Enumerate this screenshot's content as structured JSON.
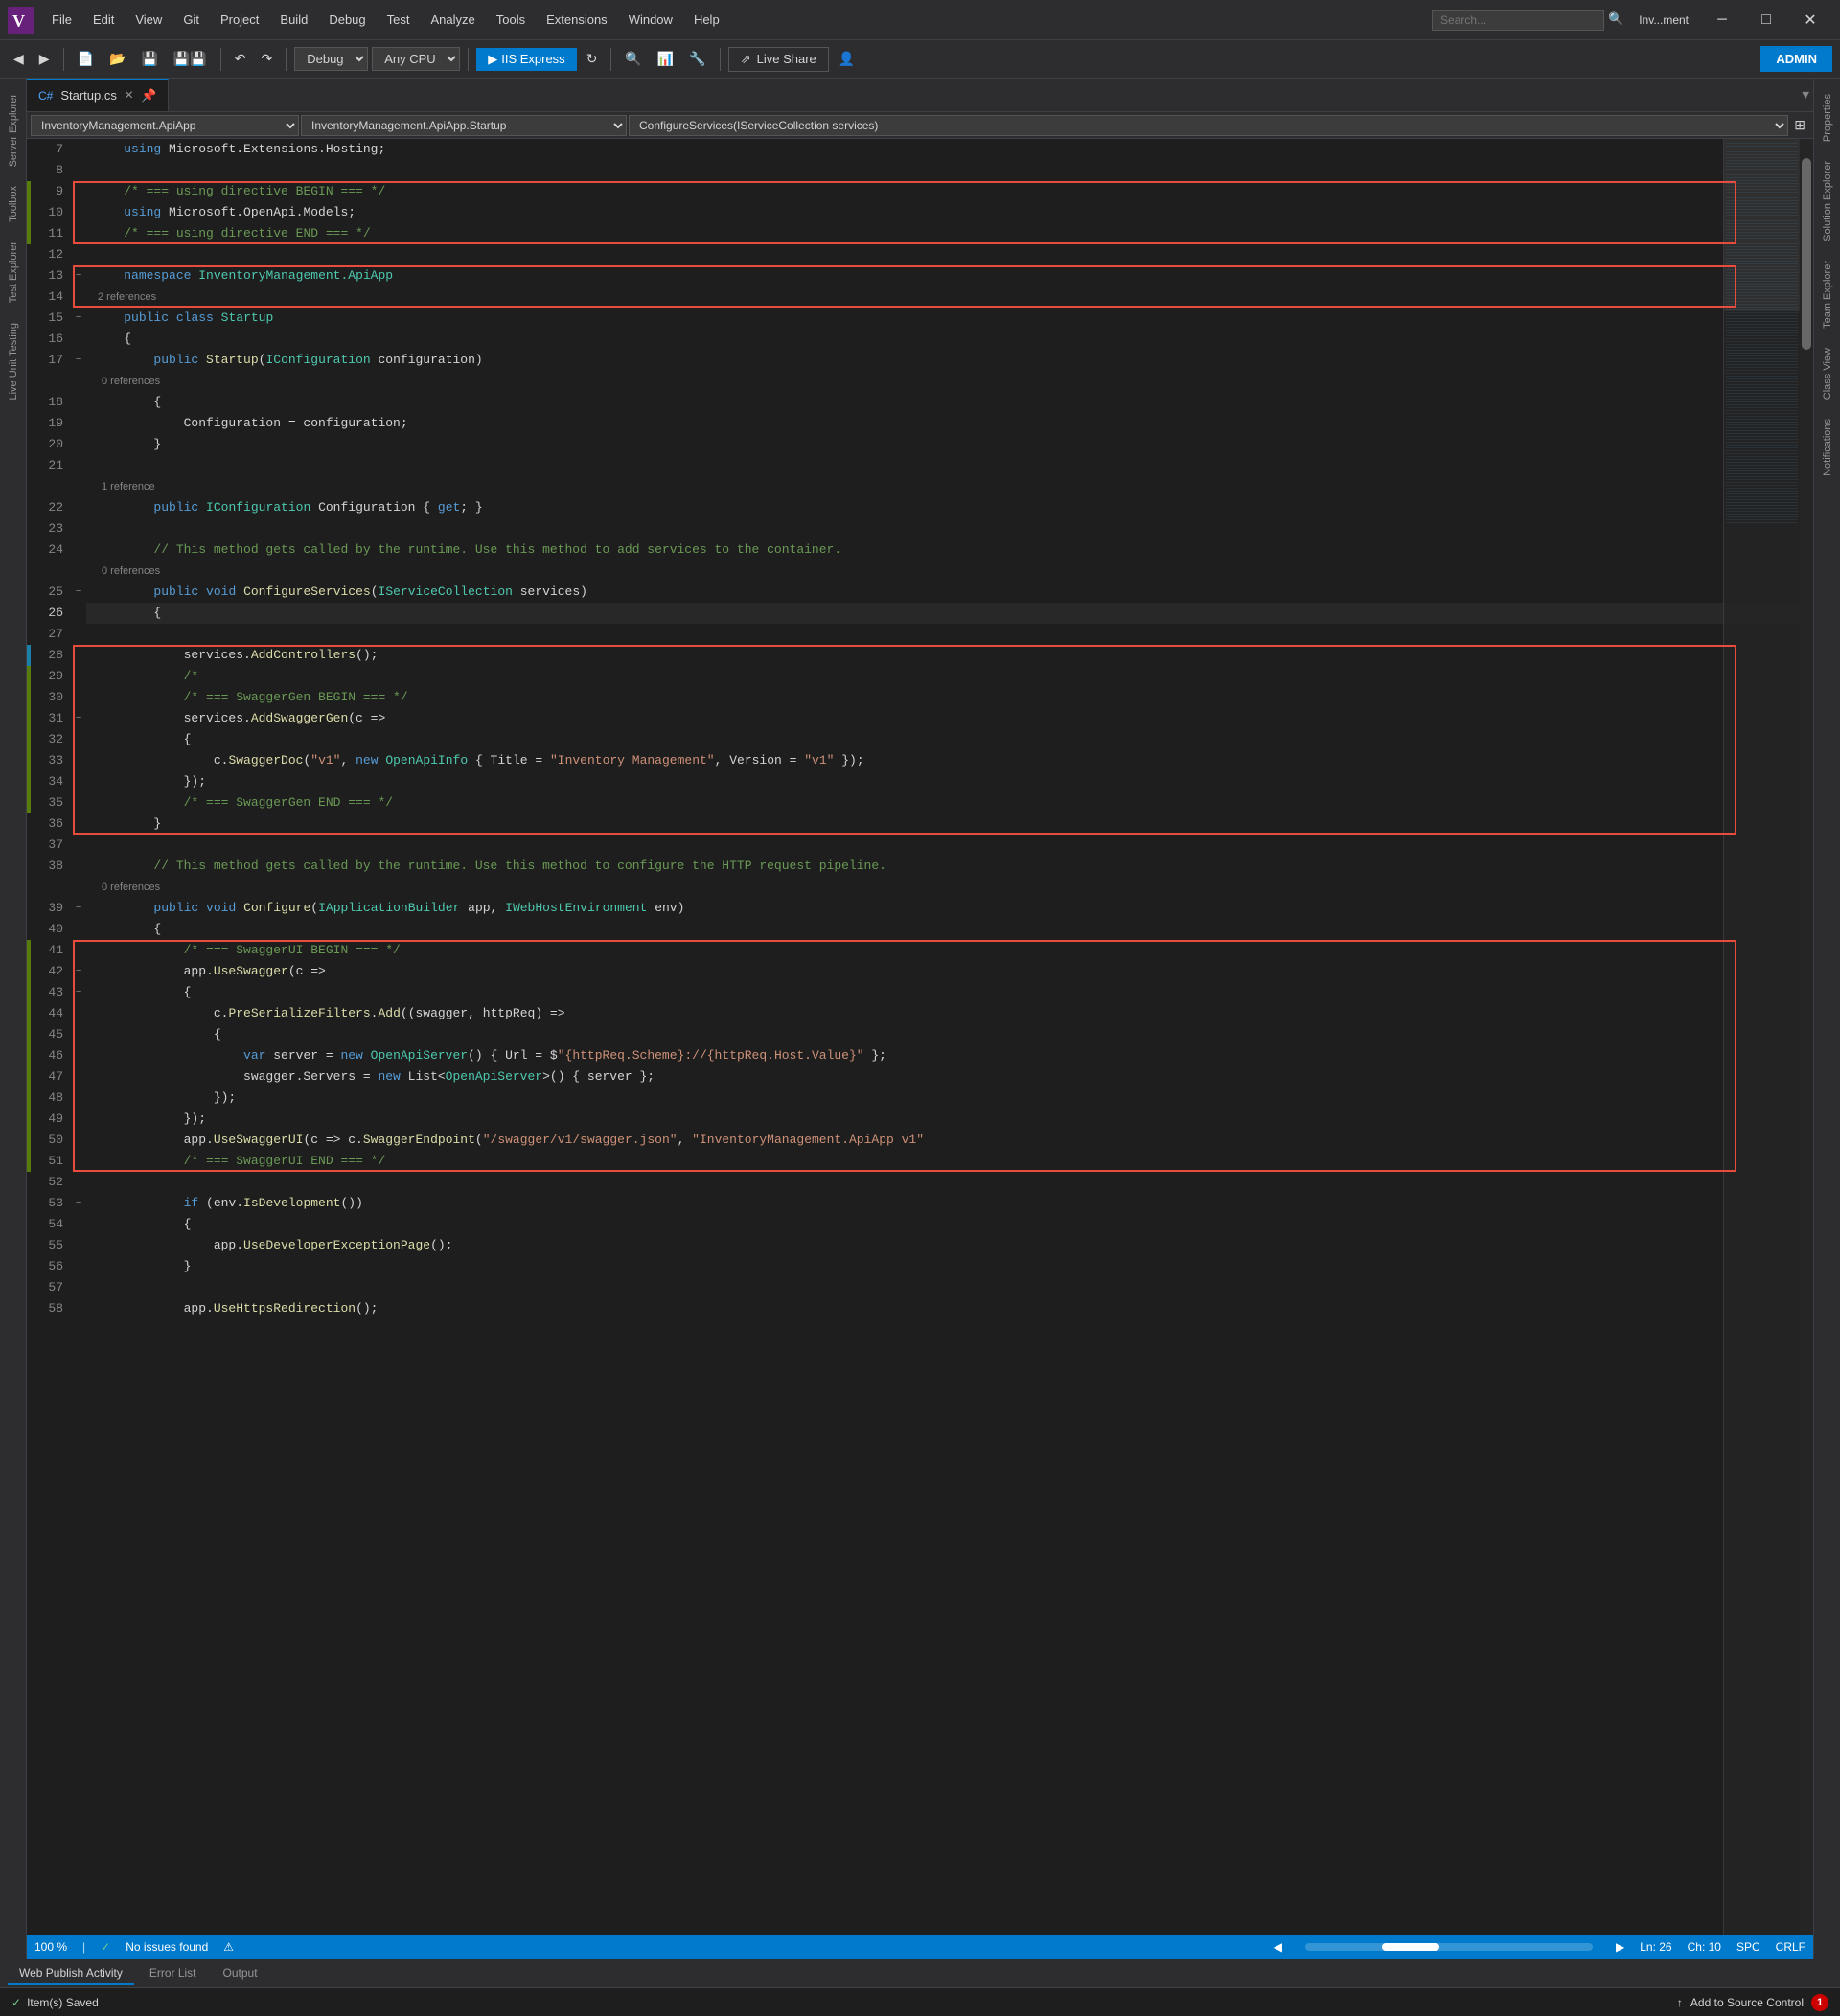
{
  "titleBar": {
    "title": "Inv...ment",
    "menuItems": [
      "File",
      "Edit",
      "View",
      "Git",
      "Project",
      "Build",
      "Debug",
      "Test",
      "Analyze",
      "Tools",
      "Extensions",
      "Window",
      "Help"
    ],
    "searchPlaceholder": "Search...",
    "controls": [
      "minimize",
      "maximize",
      "close"
    ]
  },
  "toolbar": {
    "debugMode": "Debug",
    "platform": "Any CPU",
    "runTarget": "IIS Express",
    "liveShare": "Live Share",
    "adminBtn": "ADMIN"
  },
  "tabBar": {
    "tabs": [
      {
        "label": "Startup.cs",
        "active": true,
        "modified": false
      },
      {
        "label": "Startup.cs",
        "active": false
      }
    ]
  },
  "navBar": {
    "namespace": "InventoryManagement.ApiApp",
    "class": "InventoryManagement.ApiApp.Startup",
    "method": "ConfigureServices(IServiceCollection services)"
  },
  "sidebarTabs": {
    "left": [
      "Server Explorer",
      "Toolbox",
      "Test Explorer",
      "Live Unit Testing"
    ],
    "right": [
      "Properties",
      "Solution Explorer",
      "Team Explorer",
      "Class View",
      "Notifications"
    ]
  },
  "codeLines": [
    {
      "num": 7,
      "git": "none",
      "indent": 0,
      "content": "    using Microsoft.Extensions.Hosting;"
    },
    {
      "num": 8,
      "git": "none",
      "indent": 0,
      "content": ""
    },
    {
      "num": 9,
      "git": "added",
      "indent": 0,
      "content": "    /* === using directive BEGIN === */"
    },
    {
      "num": 10,
      "git": "added",
      "indent": 0,
      "content": "    using Microsoft.OpenApi.Models;"
    },
    {
      "num": 11,
      "git": "added",
      "indent": 0,
      "content": "    /* === using directive END === */"
    },
    {
      "num": 12,
      "git": "none",
      "indent": 0,
      "content": ""
    },
    {
      "num": 13,
      "git": "none",
      "indent": 0,
      "content": "    namespace InventoryManagement.ApiApp"
    },
    {
      "num": 14,
      "git": "none",
      "indent": 0,
      "content": ""
    },
    {
      "num": 15,
      "git": "none",
      "indent": 0,
      "content": "    public class Startup"
    },
    {
      "num": 16,
      "git": "none",
      "indent": 0,
      "content": "    {"
    },
    {
      "num": 17,
      "git": "none",
      "indent": 0,
      "content": "        public Startup(IConfiguration configuration)"
    },
    {
      "num": 18,
      "git": "none",
      "indent": 0,
      "content": "        {"
    },
    {
      "num": 19,
      "git": "none",
      "indent": 0,
      "content": "            Configuration = configuration;"
    },
    {
      "num": 20,
      "git": "none",
      "indent": 0,
      "content": "        }"
    },
    {
      "num": 21,
      "git": "none",
      "indent": 0,
      "content": ""
    },
    {
      "num": 22,
      "git": "none",
      "indent": 0,
      "content": "        public IConfiguration Configuration { get; }"
    },
    {
      "num": 23,
      "git": "none",
      "indent": 0,
      "content": ""
    },
    {
      "num": 24,
      "git": "none",
      "indent": 0,
      "content": "        // This method gets called by the runtime. Use this method to add services to the container."
    },
    {
      "num": 25,
      "git": "none",
      "indent": 0,
      "content": "        public void ConfigureServices(IServiceCollection services)"
    },
    {
      "num": 26,
      "git": "none",
      "indent": 0,
      "content": "        {"
    },
    {
      "num": 27,
      "git": "none",
      "indent": 0,
      "content": ""
    },
    {
      "num": 28,
      "git": "modified",
      "indent": 0,
      "content": "            services.AddControllers();"
    },
    {
      "num": 29,
      "git": "added",
      "indent": 0,
      "content": "            /*"
    },
    {
      "num": 30,
      "git": "added",
      "indent": 0,
      "content": "            /* === SwaggerGen BEGIN === */"
    },
    {
      "num": 31,
      "git": "added",
      "indent": 0,
      "content": "            services.AddSwaggerGen(c =>"
    },
    {
      "num": 32,
      "git": "added",
      "indent": 0,
      "content": "            {"
    },
    {
      "num": 33,
      "git": "added",
      "indent": 0,
      "content": "                c.SwaggerDoc(\"v1\", new OpenApiInfo { Title = \"Inventory Management\", Version = \"v1\" });"
    },
    {
      "num": 34,
      "git": "added",
      "indent": 0,
      "content": "            });"
    },
    {
      "num": 35,
      "git": "added",
      "indent": 0,
      "content": "            /* === SwaggerGen END === */"
    },
    {
      "num": 36,
      "git": "none",
      "indent": 0,
      "content": "        }"
    },
    {
      "num": 37,
      "git": "none",
      "indent": 0,
      "content": ""
    },
    {
      "num": 38,
      "git": "none",
      "indent": 0,
      "content": "        // This method gets called by the runtime. Use this method to configure the HTTP request pipeline."
    },
    {
      "num": 39,
      "git": "none",
      "indent": 0,
      "content": "        public void Configure(IApplicationBuilder app, IWebHostEnvironment env)"
    },
    {
      "num": 40,
      "git": "none",
      "indent": 0,
      "content": "        {"
    },
    {
      "num": 41,
      "git": "added",
      "indent": 0,
      "content": "            /* === SwaggerUI BEGIN === */"
    },
    {
      "num": 42,
      "git": "added",
      "indent": 0,
      "content": "            app.UseSwagger(c =>"
    },
    {
      "num": 43,
      "git": "added",
      "indent": 0,
      "content": "            {"
    },
    {
      "num": 44,
      "git": "added",
      "indent": 0,
      "content": "                c.PreSerializeFilters.Add((swagger, httpReq) =>"
    },
    {
      "num": 45,
      "git": "added",
      "indent": 0,
      "content": "                {"
    },
    {
      "num": 46,
      "git": "added",
      "indent": 0,
      "content": "                    var server = new OpenApiServer() { Url = $\"{httpReq.Scheme}://{httpReq.Host.Value}\" };"
    },
    {
      "num": 47,
      "git": "added",
      "indent": 0,
      "content": "                    swagger.Servers = new List<OpenApiServer>() { server };"
    },
    {
      "num": 48,
      "git": "added",
      "indent": 0,
      "content": "                });"
    },
    {
      "num": 49,
      "git": "added",
      "indent": 0,
      "content": "            });"
    },
    {
      "num": 50,
      "git": "added",
      "indent": 0,
      "content": "            app.UseSwaggerUI(c => c.SwaggerEndpoint(\"/swagger/v1/swagger.json\", \"InventoryManagement.ApiApp v1\""
    },
    {
      "num": 51,
      "git": "added",
      "indent": 0,
      "content": "            /* === SwaggerUI END === */"
    },
    {
      "num": 52,
      "git": "none",
      "indent": 0,
      "content": ""
    },
    {
      "num": 53,
      "git": "none",
      "indent": 0,
      "content": "            if (env.IsDevelopment())"
    },
    {
      "num": 54,
      "git": "none",
      "indent": 0,
      "content": "            {"
    },
    {
      "num": 55,
      "git": "none",
      "indent": 0,
      "content": "                app.UseDeveloperExceptionPage();"
    },
    {
      "num": 56,
      "git": "none",
      "indent": 0,
      "content": "            }"
    },
    {
      "num": 57,
      "git": "none",
      "indent": 0,
      "content": ""
    },
    {
      "num": 58,
      "git": "none",
      "indent": 0,
      "content": "            app.UseHttpsRedirection();"
    }
  ],
  "statusBar": {
    "zoom": "100 %",
    "status": "No issues found",
    "lineInfo": "Ln: 26",
    "charInfo": "Ch: 10",
    "encoding": "SPC",
    "lineEnding": "CRLF"
  },
  "bottomTabs": {
    "tabs": [
      "Web Publish Activity",
      "Error List",
      "Output"
    ],
    "active": "Web Publish Activity"
  },
  "bottomStatus": {
    "savedText": "Item(s) Saved",
    "sourceControl": "Add to Source Control",
    "badge": "1"
  }
}
